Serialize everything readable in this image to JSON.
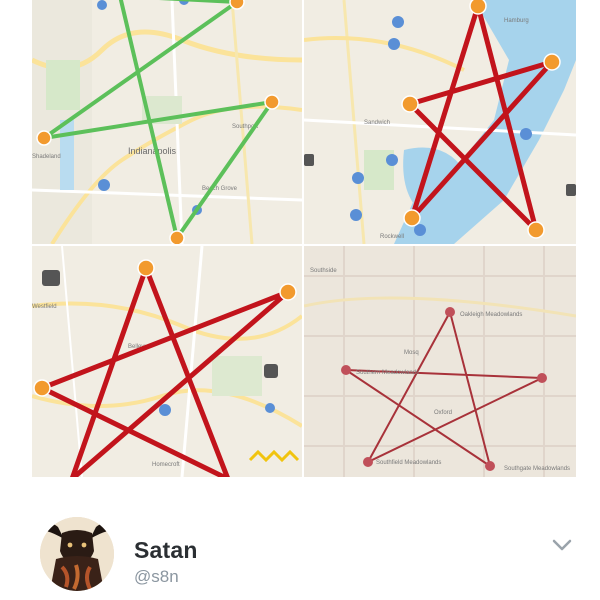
{
  "tweet": {
    "author": {
      "display_name": "Satan",
      "handle": "@s8n",
      "avatar_icon": "bull-devil-avatar"
    },
    "more_menu_icon": "chevron-down-icon"
  },
  "media": {
    "tiles": [
      {
        "pentagram_color": "#5cc05a",
        "label": "Indianapolis"
      },
      {
        "pentagram_color": "#c2141c"
      },
      {
        "pentagram_color": "#c2141c"
      },
      {
        "pentagram_color": "#a8323a"
      }
    ]
  },
  "colors": {
    "pin_orange": "#f29a2e",
    "water": "#9fd0ea",
    "road_yellow": "#f6d55c",
    "handle_gray": "#8b96a0",
    "name_dark": "#2b2f33"
  }
}
